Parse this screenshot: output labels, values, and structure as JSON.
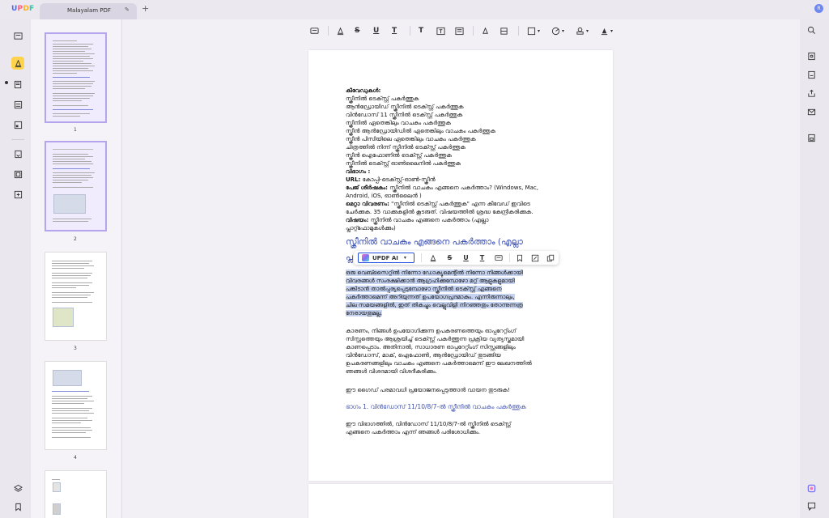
{
  "app": {
    "logo": "UPDF",
    "tab_title": "Malayalam PDF",
    "user_initial": "R"
  },
  "thumbnails": [
    {
      "page": "1",
      "selected": true
    },
    {
      "page": "2",
      "selected": true
    },
    {
      "page": "3",
      "selected": false
    },
    {
      "page": "4",
      "selected": false
    }
  ],
  "floating_toolbar": {
    "ai_label": "UPDF AI"
  },
  "document": {
    "lines": [
      "കീവേഡുകൾ:",
      "സ്ക്രീനിൽ ടെക്സ്റ്റ് പകർത്തുക",
      "ആൻഡ്രോയിഡ് സ്ക്രീനിൽ ടെക്സ്റ്റ് പകർത്തുക",
      "വിൻഡോസ് 11 സ്ക്രീനിൽ ടെക്സ്റ്റ് പകർത്തുക",
      "സ്ക്രീനിൽ ഏതെങ്കിലും വാചകം പകർത്തുക",
      "സ്ക്രീൻ ആൻഡ്രോയിഡിൽ ഏതെങ്കിലും വാചകം പകർത്തുക",
      "സ്ക്രീൻ പിസിയിലെ ഏതെങ്കിലും വാചകം പകർത്തുക",
      "ചിത്രത്തിൽ നിന്ന് സ്ക്രീനിൽ ടെക്സ്റ്റ് പകർത്തുക",
      "സ്ക്രീൻ ഐഫോണിൽ ടെക്സ്റ്റ് പകർത്തുക",
      "സ്ക്രീനിൽ ടെക്സ്റ്റ് ഓൺലൈനിൽ പകർത്തുക"
    ],
    "viabhagam": "വിഭാഗം :",
    "url_label": "URL:",
    "url_value": " കോപ്പി-ടെക്സ്റ്റ്-ഓൺ-സ്ക്രീൻ",
    "page_title_label": "പേജ് ശീർഷകം:",
    "page_title_value": " സ്ക്രീനിൽ വാചകം എങ്ങനെ പകർത്താം? (Windows, Mac,",
    "page_title_value2": "Android, iOS, ഓൺലൈൻ )",
    "meta_label": "മെറ്റാ വിവരണം:",
    "meta_value": " \"സ്ക്രീനിൽ ടെക്സ്റ്റ് പകർത്തുക\" എന്ന കീവേഡ് ഇവിടെ",
    "meta_value2": "ചേർക്കുക. 35 വാക്കുകളിൽ കൂടരുത്. വിഷയത്തിൽ ശ്രദ്ധ കേന്ദ്രീകരിക്കുക.",
    "topic_label": "വിഷയം:",
    "topic_value": " സ്ക്രീനിൽ വാചകം എങ്ങനെ പകർത്താം (എല്ലാ",
    "topic_value2": "പ്ലാറ്റ്ഫോമുകൾക്കും)",
    "heading": "സ്ക്രീനിൽ വാചകം എങ്ങനെ പകർത്താം (എല്ലാ",
    "heading_cont": "പ്ല",
    "highlighted": [
      "ഒരു വെബ്സൈറ്റിൽ നിന്നോ ഡോക്യുമെന്റിൽ നിന്നോ നിങ്ങൾക്കായി",
      "വിവരങ്ങൾ സംരക്ഷിക്കാൻ ആഗ്രഹിക്കുമ്പോഴോ മറ്റ് ആളുകളുമായി",
      "പങ്കിടാൻ താൽപ്പര്യപ്പെടുമ്പോഴോ സ്ക്രീനിൽ ടെക്സ്റ്റ് എങ്ങനെ",
      "പകർത്താമെന്ന് അറിയുന്നത് ഉപയോഗപ്രദമാകും. എന്നിരുന്നാലും,",
      "ചില സമയങ്ങളിൽ, ഇത് തികച്ചും വെല്ലുവിളി നിറഞ്ഞതും തോന്നുന്നത്ര",
      "നേരായതുമല്ല."
    ],
    "para2": [
      "കാരണം, നിങ്ങൾ ഉപയോഗിക്കുന്ന ഉപകരണത്തെയും ഓപ്പറേറ്റിംഗ്",
      "സിസ്റ്റത്തെയും ആശ്രയിച്ച് ടെക്സ്റ്റ് പകർത്തുന്ന പ്രക്രിയ വ്യത്യസ്തമായി",
      "കാണപ്പെടാം. അതിനാൽ, സാധാരണ ഓപ്പറേറ്റിംഗ് സിസ്റ്റങ്ങളിലും",
      "വിൻഡോസ്, മാക്, ഐഫോൺ, ആൻഡ്രോയിഡ് തുടങ്ങിയ",
      "ഉപകരണങ്ങളിലും വാചകം എങ്ങനെ പകർത്താമെന്ന് ഈ ലേഖനത്തിൽ",
      "ഞങ്ങൾ വിശദമായി വിശദീകരിക്കും."
    ],
    "para3": "ഈ ഗൈഡ് പരമാവധി പ്രയോജനപ്പെടുത്താൻ വായന തുടരുക!",
    "subheading": "ഭാഗം 1. വിൻഡോസ് 11/10/8/7-ൽ സ്ക്രീനിൽ വാചകം പകർത്തുക",
    "para4": [
      "ഈ വിഭാഗത്തിൽ, വിൻഡോസ് 11/10/8/7-ൽ സ്ക്രീനിൽ ടെക്സ്റ്റ്",
      "എങ്ങനെ പകർത്താം എന്ന് ഞങ്ങൾ പരിശോധിക്കും."
    ]
  }
}
